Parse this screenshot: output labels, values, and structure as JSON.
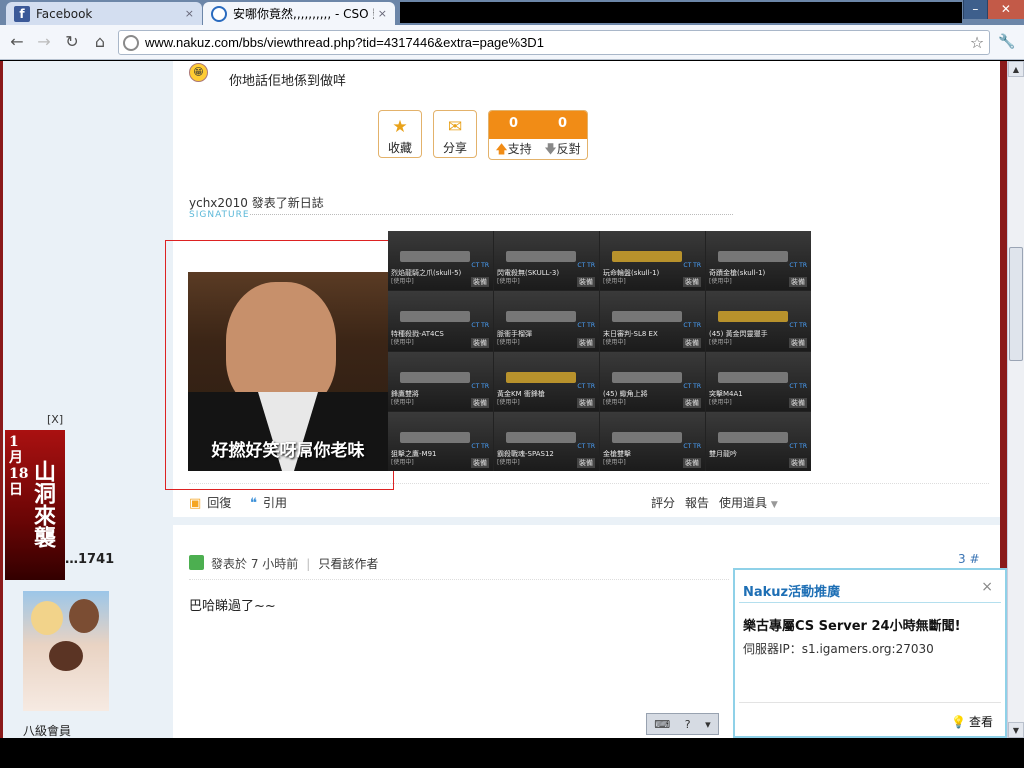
{
  "browser": {
    "tabs": [
      {
        "icon": "f",
        "title": "Facebook",
        "close": "×"
      },
      {
        "title": "安哪你竟然,,,,,,,,,, - CSO 影區",
        "close": "×"
      }
    ],
    "window_controls": {
      "minimize": "–",
      "maximize": "▭",
      "close": "✕"
    },
    "url": "www.nakuz.com/bbs/viewthread.php?tid=4317446&extra=page%3D1",
    "nav": {
      "back": "←",
      "forward": "→",
      "reload": "↻",
      "home": "⌂",
      "star": "☆",
      "wrench": "🔧"
    }
  },
  "post1": {
    "message": "你地話佢地係到做咩",
    "smiley": "😁",
    "favorite_label": "收藏",
    "share_label": "分享",
    "support_count": "0",
    "oppose_count": "0",
    "support_label": "支持",
    "oppose_label": "反對",
    "signature_title": "ychx2010 發表了新日誌",
    "signature_label": "SIGNATURE",
    "meme_caption": "好撚好笑呀屌你老味",
    "weapons": [
      {
        "name": "烈焰龍騎之爪(skull-5)",
        "sub": "[使用中]",
        "tag": "裝備",
        "gold": false
      },
      {
        "name": "閃電殺無(SKULL-3)",
        "sub": "[使用中]",
        "tag": "裝備",
        "gold": false
      },
      {
        "name": "玩命輪盤(skull-1)",
        "sub": "[使用中]",
        "tag": "裝備",
        "gold": true
      },
      {
        "name": "奇蹟金槍(skull-1)",
        "sub": "[使用中]",
        "tag": "裝備",
        "gold": false
      },
      {
        "name": "特種殺戮-AT4CS",
        "sub": "[使用中]",
        "tag": "裝備",
        "gold": false
      },
      {
        "name": "脈衝手榴彈",
        "sub": "[使用中]",
        "tag": "裝備",
        "gold": false
      },
      {
        "name": "末日審判-SL8 EX",
        "sub": "[使用中]",
        "tag": "裝備",
        "gold": false
      },
      {
        "name": "(45) 黃金閃靈獵手",
        "sub": "[使用中]",
        "tag": "裝備",
        "gold": true
      },
      {
        "name": "鋒鷹雙將",
        "sub": "[使用中]",
        "tag": "裝備",
        "gold": false
      },
      {
        "name": "黃金KM 衝鋒槍",
        "sub": "[使用中]",
        "tag": "裝備",
        "gold": true
      },
      {
        "name": "(45) 蠍角上將",
        "sub": "[使用中]",
        "tag": "裝備",
        "gold": false
      },
      {
        "name": "突擊M4A1",
        "sub": "[使用中]",
        "tag": "裝備",
        "gold": false
      },
      {
        "name": "狙擊之鷹-M91",
        "sub": "[使用中]",
        "tag": "裝備",
        "gold": false
      },
      {
        "name": "霸殺戰魂-SPAS12",
        "sub": "[使用中]",
        "tag": "裝備",
        "gold": false
      },
      {
        "name": "金槍雙擊",
        "sub": "[使用中]",
        "tag": "裝備",
        "gold": false
      },
      {
        "name": "雙月龍吟",
        "sub": "",
        "tag": "裝備",
        "gold": false
      }
    ],
    "ct_tag": "CT TR",
    "actions": {
      "reply": "回復",
      "quote": "引用",
      "rate": "評分",
      "report": "報告",
      "tools": "使用道具"
    }
  },
  "ad": {
    "close_label": "[X]",
    "date_text": "1月18日",
    "banner_text": "山洞來襲"
  },
  "post2": {
    "user_id": "…1741",
    "rank": "八級會員",
    "posted": "發表於 7 小時前",
    "only_author": "只看該作者",
    "floor": "3 #",
    "message": "巴哈睇過了~~"
  },
  "ime": {
    "keyboard": "⌨",
    "help": "?",
    "menu": "▾"
  },
  "popup": {
    "title": "Nakuz活動推廣",
    "close": "×",
    "message": "樂古專屬CS Server 24小時無斷聞!",
    "server_ip": "伺服器IP：s1.igamers.org:27030",
    "view_label": "查看"
  },
  "scrollbar": {
    "up": "▲",
    "down": "▼"
  },
  "colors": {
    "accent": "#f18c16",
    "frame": "#8b1a1a",
    "sidebar": "#eaf1f7",
    "popup_border": "#8fd1e8",
    "link": "#1e6fb5"
  }
}
